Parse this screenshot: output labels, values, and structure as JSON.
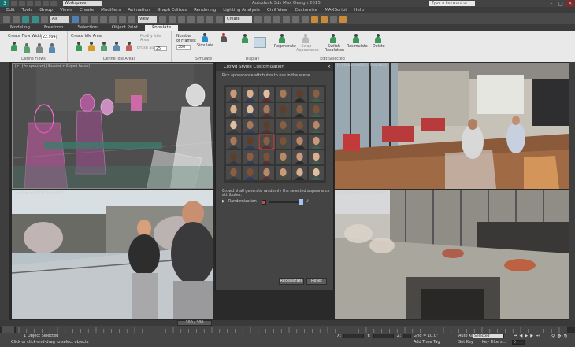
{
  "title_bar": {
    "logo": "3",
    "workspace": "Workspace: Default",
    "app_title": "Autodesk 3ds Max Design 2015",
    "search_placeholder": "Type a keyword or phrase",
    "minimize": "–",
    "maximize": "□",
    "close": "×"
  },
  "menu": [
    "Edit",
    "Tools",
    "Group",
    "Views",
    "Create",
    "Modifiers",
    "Animation",
    "Graph Editors",
    "Rendering",
    "Lighting Analysis",
    "Civil View",
    "Customize",
    "MAXScript",
    "Help"
  ],
  "toolbar": {
    "selection_filter": "All",
    "view_dropdown": "View",
    "selection_set": "Create Selection Se"
  },
  "ribbon_tabs": [
    {
      "label": "Modeling",
      "active": false
    },
    {
      "label": "Freeform",
      "active": false
    },
    {
      "label": "Selection",
      "active": false
    },
    {
      "label": "Object Paint",
      "active": false
    },
    {
      "label": "Populate",
      "active": true
    }
  ],
  "ribbon": {
    "define_flows": {
      "create_flow": "Create Flow",
      "width_label": "Width:",
      "width_value": "22.994",
      "footer": "Define Flows"
    },
    "define_idle": {
      "create_idle_area": "Create Idle Area",
      "modify_idle_area": "Modify Idle Area",
      "brush_size_label": "Brush Size:",
      "brush_size_value": "25",
      "footer": "Define Idle Areas"
    },
    "simulate": {
      "number_label": "Number",
      "of_frames_label": "of Frames:",
      "frames_value": "300",
      "simulate": "Simulate",
      "footer": "Simulate"
    },
    "display": {
      "footer": "Display"
    },
    "edit_selected": {
      "regenerate": "Regenerate",
      "swap_appearance": "Swap Appearance",
      "switch_resolution": "Switch Resolution",
      "re_simulate": "Resimulate",
      "delete": "Delete",
      "footer": "Edit Selected"
    }
  },
  "viewports": {
    "top_left": "[+] [Perspective] [Shaded + Edged Faces]",
    "top_right": "[+] [Camera001] [Realistic]",
    "bottom_left": "[+] [Camera002] [Realistic]",
    "bottom_right": "[+] [Camera003] [Realistic]"
  },
  "dialog": {
    "title": "Crowd Styles Customization",
    "close": "×",
    "instruction": "Pick appearance attributes to use in the scene.",
    "apply_instruction": "Crowd shall generate randomly the selected appearance attributes.",
    "randomization_label": "Randomization",
    "regenerate": "Regenerate",
    "reset": "Reset"
  },
  "timeline": {
    "frame_counter": "100 / 300"
  },
  "status": {
    "selection": "1 Object Selected",
    "prompt": "Click or click-and-drag to select objects",
    "x_label": "X:",
    "y_label": "Y:",
    "z_label": "Z:",
    "grid": "Grid = 10.0\"",
    "add_time_tag": "Add Time Tag",
    "auto_key": "Auto Key",
    "set_key": "Set Key",
    "key_filter": "Selected",
    "key_filters_button": "Key Filters...",
    "frame_value": "0"
  }
}
